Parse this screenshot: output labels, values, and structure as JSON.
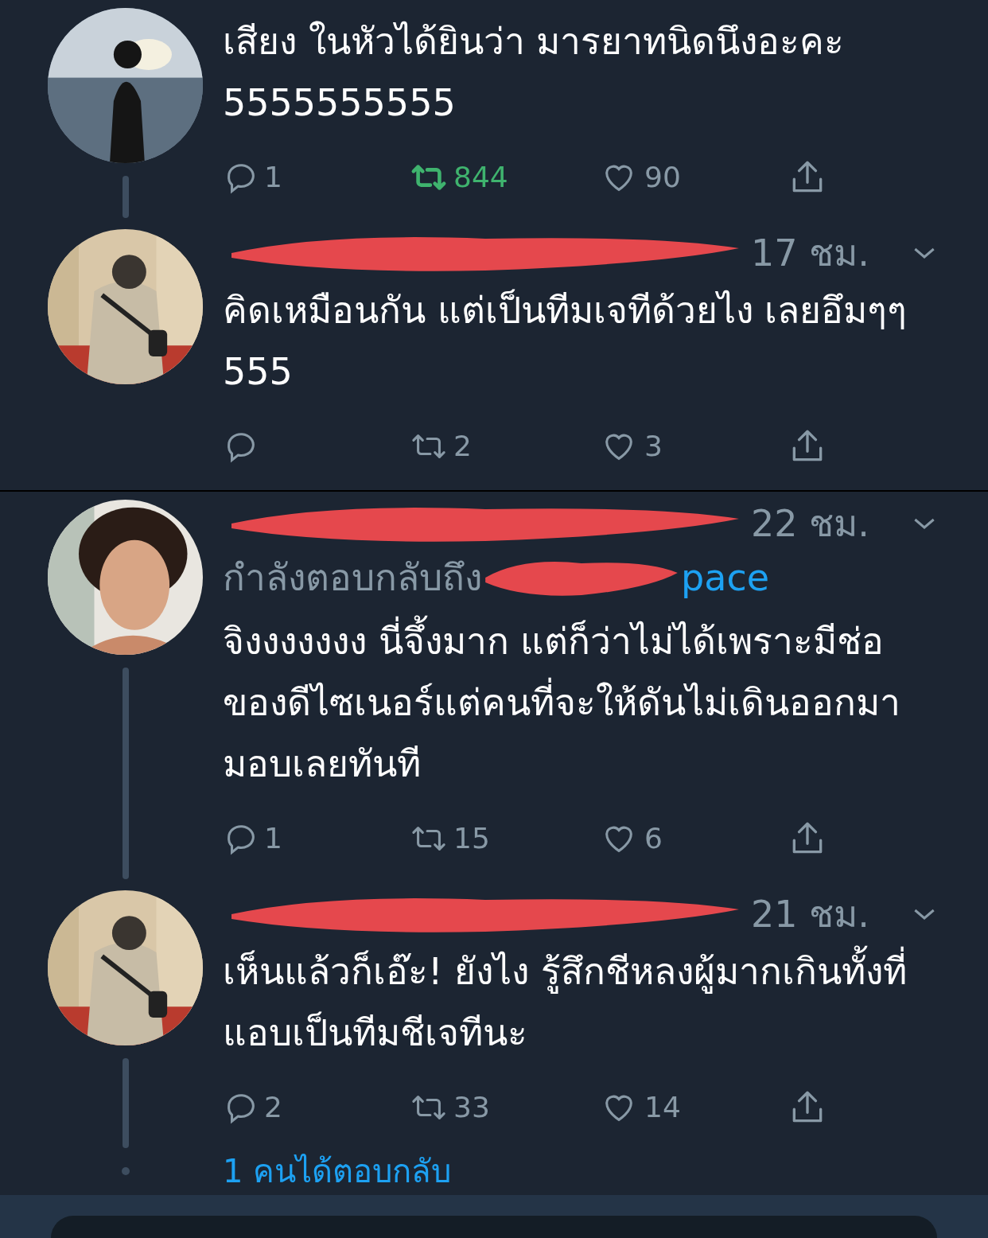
{
  "tweets": [
    {
      "text": "เสียง ในหัวได้ยินว่า มารยาทนิดนึงอะคะ 5555555555",
      "actions": {
        "replies": "1",
        "retweets": "844",
        "retweeted": true,
        "likes": "90"
      },
      "thread_line": true,
      "divider_after": false
    },
    {
      "header": {
        "time": "17 ชม."
      },
      "text": "คิดเหมือนกัน แต่เป็นทีมเจทีด้วยไง เลยอึมๆๆ 555",
      "actions": {
        "retweets": "2",
        "retweeted": false,
        "likes": "3"
      },
      "thread_line": false,
      "divider_after": true
    },
    {
      "header": {
        "time": "22 ชม."
      },
      "reply_to": {
        "label": "กำลังตอบกลับถึง",
        "handle": "pace"
      },
      "text": "จิงงงงงงง นี่จึ้งมาก แต่ก็ว่าไม่ได้เพราะมีช่อของดีไซเนอร์แต่คนที่จะให้ดันไม่เดินออกมามอบเลยทันที",
      "actions": {
        "replies": "1",
        "retweets": "15",
        "retweeted": false,
        "likes": "6"
      },
      "thread_line": true,
      "divider_after": false
    },
    {
      "header": {
        "time": "21 ชม."
      },
      "text": "เห็นแล้วก็เอ๊ะ! ยังไง รู้สึกชีหลงผู้มากเกินทั้งที่แอบเป็นทีมชีเจทีนะ",
      "actions": {
        "replies": "2",
        "retweets": "33",
        "retweeted": false,
        "likes": "14"
      },
      "thread_line": true,
      "divider_after": false
    }
  ],
  "more_replies": "1 คนได้ตอบกลับ"
}
